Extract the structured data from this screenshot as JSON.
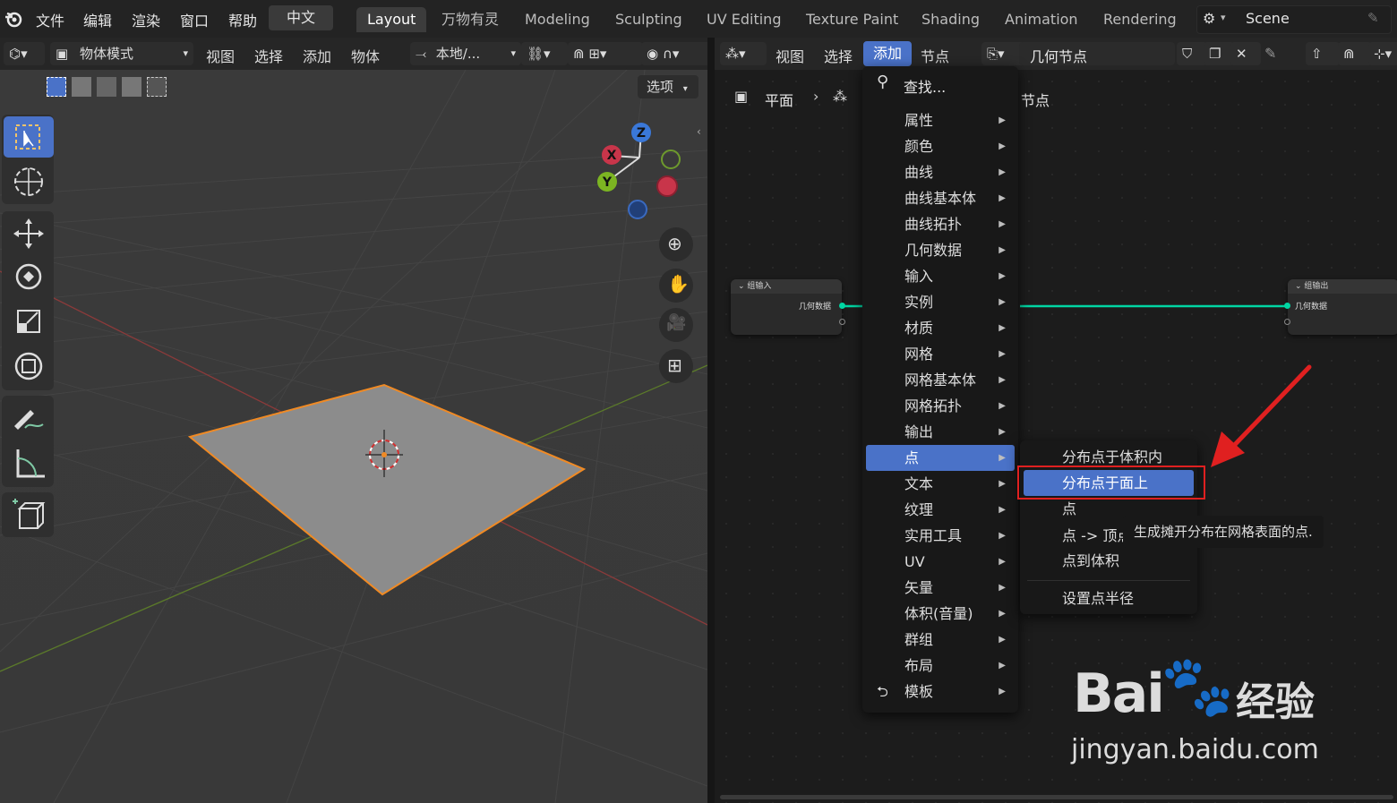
{
  "topbar": {
    "menus": [
      "文件",
      "编辑",
      "渲染",
      "窗口",
      "帮助"
    ],
    "language": "中文",
    "workspace_tabs": [
      "Layout",
      "万物有灵",
      "Modeling",
      "Sculpting",
      "UV Editing",
      "Texture Paint",
      "Shading",
      "Animation",
      "Rendering"
    ],
    "scene": "Scene"
  },
  "viewport_header": {
    "mode": "物体模式",
    "menus": [
      "视图",
      "选择",
      "添加",
      "物体"
    ],
    "transform_orientation": "本地/...",
    "options": "选项"
  },
  "gizmo": {
    "z": "Z",
    "x": "X",
    "y": "Y"
  },
  "node_header": {
    "menus": [
      "视图",
      "选择",
      "添加",
      "节点"
    ],
    "tree_name": "几何节点"
  },
  "breadcrumb": {
    "object": "平面",
    "modifier_tail": "节点"
  },
  "nodes": {
    "group_input": {
      "title": "组输入",
      "socket": "几何数据"
    },
    "group_output": {
      "title": "组输出",
      "socket": "几何数据"
    }
  },
  "add_menu": {
    "search": "查找...",
    "items": [
      "属性",
      "颜色",
      "曲线",
      "曲线基本体",
      "曲线拓扑",
      "几何数据",
      "输入",
      "实例",
      "材质",
      "网格",
      "网格基本体",
      "网格拓扑",
      "输出",
      "点",
      "文本",
      "纹理",
      "实用工具",
      "UV",
      "矢量",
      "体积(音量)",
      "群组",
      "布局",
      "模板"
    ],
    "selected": "点"
  },
  "points_submenu": {
    "items": [
      "分布点于体积内",
      "分布点于面上",
      "点",
      "点 -> 顶点",
      "点到体积",
      "设置点半径"
    ],
    "selected": "分布点于面上"
  },
  "tooltip": "生成摊开分布在网格表面的点.",
  "watermark": {
    "brand": "Bai",
    "brand2": "经验",
    "url": "jingyan.baidu.com"
  },
  "colors": {
    "accent": "#4a72c8",
    "socket_geometry": "#00d6a3",
    "highlight": "#e02020",
    "selection_outline": "#f08a24"
  }
}
